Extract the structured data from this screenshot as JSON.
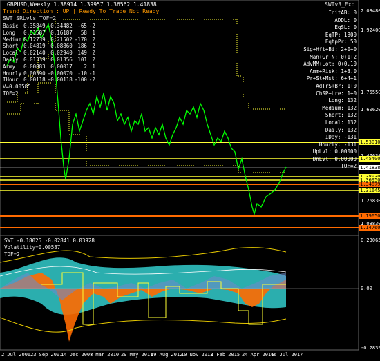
{
  "header": {
    "title": "GBPUSD,Weekly  1.38914 1.39957 1.36562 1.41838",
    "indicator_name": "SWTv3_Exp"
  },
  "trend_line": "Trend Direction : UP  |  Ready To Trade  Not Ready",
  "srlvls": "SWT_SRLvls TOF=2",
  "stats": [
    [
      "Basic",
      "0.35849",
      "-0.34482",
      "-65",
      "-2"
    ],
    [
      "Long",
      "0.31587",
      "0.16187",
      "58",
      "1"
    ],
    [
      "Medium",
      "0.12739",
      "0.21502",
      "-170",
      "2"
    ],
    [
      "Short",
      "0.04819",
      "0.08860",
      "186",
      "2"
    ],
    [
      "Local",
      "0.02140",
      "0.02940",
      "149",
      "2"
    ],
    [
      "Daily",
      "0.01339",
      "0.01356",
      "101",
      "2"
    ],
    [
      "Army",
      "0.00883",
      "0.00017",
      "2",
      "1"
    ],
    [
      "Hourly",
      "0.00390",
      "-0.00070",
      "-10",
      "-1"
    ],
    [
      "IHour",
      "0.00118",
      "-0.00118",
      "-100",
      "-2"
    ]
  ],
  "v_line": "V=0.00585",
  "tof_line": "TOF=2",
  "right_panel": [
    [
      "InitAB:",
      "0"
    ],
    [
      "ADDL:",
      "0"
    ],
    [
      "EqSL:",
      "0"
    ],
    [
      "EqTP:",
      "1800"
    ],
    [
      "EqtpPr:",
      "50"
    ],
    [
      "Sig+Hft+Bi:",
      "2+0+0"
    ],
    [
      "Man+Gr+N:",
      "0+1+2"
    ],
    [
      "AdvMM+Lot:",
      "0+0.10"
    ],
    [
      "Amm+Risk:",
      "1+3.0"
    ],
    [
      "Pr+St+Mst:",
      "6+4+1"
    ],
    [
      "AdTrS+Br:",
      "1+0"
    ],
    [
      "ChSP+Lre:",
      "1+0"
    ],
    [
      "Long:",
      "132"
    ],
    [
      "Medium:",
      "132"
    ],
    [
      "Short:",
      "132"
    ],
    [
      "Local:",
      "132"
    ],
    [
      "Daily:",
      "132"
    ],
    [
      "IDay:",
      "-131"
    ],
    [
      "Hourly:",
      "-131"
    ],
    [
      "UpLvl:",
      "0.00000"
    ],
    [
      "DnLvl:",
      "0.00000"
    ],
    [
      "TOF=2",
      ""
    ]
  ],
  "price_scale": [
    "2.03480",
    "1.92400",
    "1.75550",
    "1.60620",
    "1.47630",
    "1.34400",
    "1.26830",
    "1.08830"
  ],
  "price_labels": [
    {
      "text": "1.53010",
      "color": "#ffff33"
    },
    {
      "text": "1.45400",
      "color": "#ffff33"
    },
    {
      "text": "1.41838",
      "color": "#ffffff"
    },
    {
      "text": "1.38030",
      "color": "#ffff33"
    },
    {
      "text": "1.36950",
      "color": "#ffff33"
    },
    {
      "text": "1.34879",
      "color": "#ff6a00"
    },
    {
      "text": "1.31645",
      "color": "#ffff33"
    },
    {
      "text": "1.19650",
      "color": "#ff6a00"
    },
    {
      "text": "1.14760",
      "color": "#ff6a00"
    }
  ],
  "indicator": {
    "header": "SWT -0.18025 -0.02841 0.03928",
    "line2": "Volatility=0.00587",
    "line3": "TOF=2",
    "scale": [
      "0.23065",
      "0.00",
      "-0.28397"
    ]
  },
  "dates": [
    "2 Jul 2006",
    "23 Sep 2007",
    "14 Dec 2008",
    "7 Mar 2010",
    "29 May 2011",
    "19 Aug 2012",
    "10 Nov 2013",
    "1 Feb 2015",
    "24 Apr 2016",
    "16 Jul 2017"
  ],
  "colors": {
    "background": "#000000",
    "price": "#00ff00",
    "yellow": "#ffff33",
    "orange": "#ff6a00",
    "cyan": "#33cccc",
    "gold": "#e6c800"
  }
}
